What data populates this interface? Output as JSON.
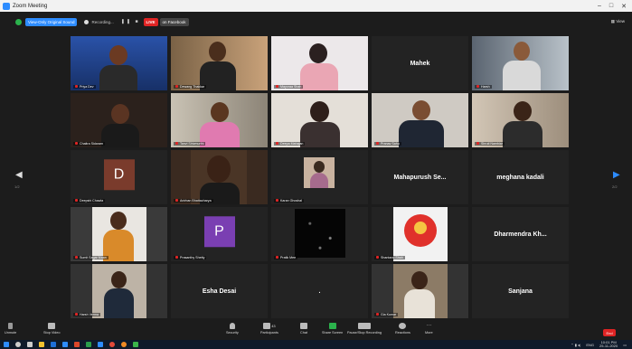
{
  "window": {
    "title": "Zoom Meeting"
  },
  "top": {
    "view_only": "View-Only Original Sound",
    "recording": "Recording...",
    "live_label": "LIVE",
    "live_target": "on Facebook",
    "view_button": "View"
  },
  "nav": {
    "left_page": "1/2",
    "right_page": "2/2"
  },
  "tiles": [
    {
      "name": "Priya Dev",
      "tile_label": ""
    },
    {
      "name": "Dewang Thakkar",
      "tile_label": ""
    },
    {
      "name": "Mayoraa Shah",
      "tile_label": ""
    },
    {
      "name": "",
      "tile_label": "Mahek"
    },
    {
      "name": "Harsh",
      "tile_label": ""
    },
    {
      "name": "Chaitra Sidaram",
      "tile_label": ""
    },
    {
      "name": "Tanvi Shivmurthi",
      "tile_label": ""
    },
    {
      "name": "Deepa Mahajan",
      "tile_label": ""
    },
    {
      "name": "Pranav Sahu",
      "tile_label": ""
    },
    {
      "name": "Shruti Nambiar",
      "tile_label": ""
    },
    {
      "name": "Deepshi Chawla",
      "tile_label": "",
      "initial": "D"
    },
    {
      "name": "Anirban Bhattacharya",
      "tile_label": ""
    },
    {
      "name": "Karan Ghoshal",
      "tile_label": ""
    },
    {
      "name": "",
      "tile_label": "Mahapurush Se..."
    },
    {
      "name": "",
      "tile_label": "meghana kadali"
    },
    {
      "name": "Sumit Sagar Maan",
      "tile_label": ""
    },
    {
      "name": "Prasanthy Shetty",
      "tile_label": "",
      "initial": "P"
    },
    {
      "name": "Pratik Mee",
      "tile_label": ""
    },
    {
      "name": "Shantanu Shah",
      "tile_label": ""
    },
    {
      "name": "",
      "tile_label": "Dharmendra Kh..."
    },
    {
      "name": "Harsh Verma",
      "tile_label": ""
    },
    {
      "name": "",
      "tile_label": "Esha Desai"
    },
    {
      "name": "",
      "tile_label": "."
    },
    {
      "name": "Gia Kumar",
      "tile_label": ""
    },
    {
      "name": "",
      "tile_label": "Sanjana"
    }
  ],
  "toolbar": {
    "unmute": "Unmute",
    "stop_video": "Stop Video",
    "security": "Security",
    "participants": "Participants",
    "participants_count": "43",
    "chat": "Chat",
    "share_screen": "Share Screen",
    "pause_recording": "Pause/Stop Recording",
    "reactions": "Reactions",
    "more": "More",
    "end": "End"
  },
  "taskbar": {
    "time": "10:01 PM",
    "date": "25-11-2020",
    "lang": "ENG"
  },
  "colors": {
    "accent": "#2d8cff",
    "danger": "#e02424",
    "active_speaker": "#f5d90a"
  }
}
